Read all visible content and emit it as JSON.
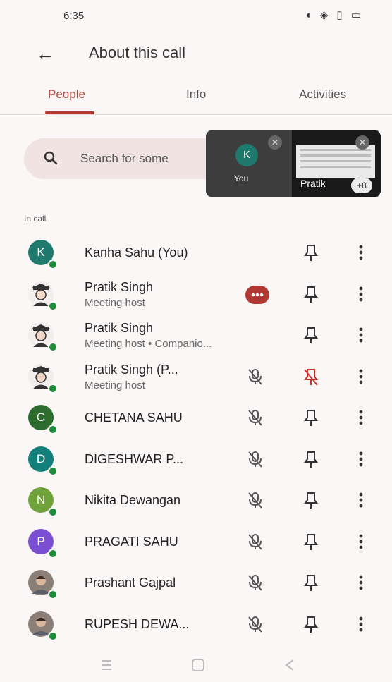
{
  "status_bar": {
    "time": "6:35",
    "icons": "◖ ◈ ▯ ▭"
  },
  "appbar": {
    "title": "About this call"
  },
  "tabs": [
    {
      "label": "People",
      "active": true
    },
    {
      "label": "Info",
      "active": false
    },
    {
      "label": "Activities",
      "active": false
    }
  ],
  "search": {
    "placeholder": "Search for some"
  },
  "pip": {
    "self_initial": "K",
    "self_label": "You",
    "other_label": "Pratik",
    "more_count": "+8"
  },
  "section_label": "In call",
  "participants": [
    {
      "name": "Kanha Sahu (You)",
      "subtitle": "",
      "initial": "K",
      "avatar_color": "#1f7a6d",
      "audio": "none",
      "pin_muted": false
    },
    {
      "name": "Pratik Singh",
      "subtitle": "Meeting host",
      "initial": "",
      "avatar_color": "",
      "audio": "speaking",
      "pin_muted": false
    },
    {
      "name": "Pratik Singh",
      "subtitle": "Meeting host • Companio...",
      "initial": "",
      "avatar_color": "",
      "audio": "none",
      "pin_muted": false
    },
    {
      "name": "Pratik Singh (P...",
      "subtitle": "Meeting host",
      "initial": "",
      "avatar_color": "",
      "audio": "muted",
      "pin_muted": true
    },
    {
      "name": "CHETANA SAHU",
      "subtitle": "",
      "initial": "C",
      "avatar_color": "#2e6b2e",
      "audio": "muted",
      "pin_muted": false
    },
    {
      "name": "DIGESHWAR P...",
      "subtitle": "",
      "initial": "D",
      "avatar_color": "#127f7a",
      "audio": "muted",
      "pin_muted": false
    },
    {
      "name": "Nikita Dewangan",
      "subtitle": "",
      "initial": "N",
      "avatar_color": "#6fa33a",
      "audio": "muted",
      "pin_muted": false
    },
    {
      "name": "PRAGATI SAHU",
      "subtitle": "",
      "initial": "P",
      "avatar_color": "#7a4fd1",
      "audio": "muted",
      "pin_muted": false
    },
    {
      "name": "Prashant Gajpal",
      "subtitle": "",
      "initial": "",
      "avatar_color": "photo",
      "audio": "muted",
      "pin_muted": false
    },
    {
      "name": "RUPESH DEWA...",
      "subtitle": "",
      "initial": "",
      "avatar_color": "photo",
      "audio": "muted",
      "pin_muted": false
    }
  ],
  "icons": {
    "back": "arrow-back-icon",
    "search": "search-icon",
    "pin": "pin-icon",
    "mic_off": "mic-off-icon",
    "more": "more-vert-icon",
    "speaking": "audio-wave-icon"
  }
}
